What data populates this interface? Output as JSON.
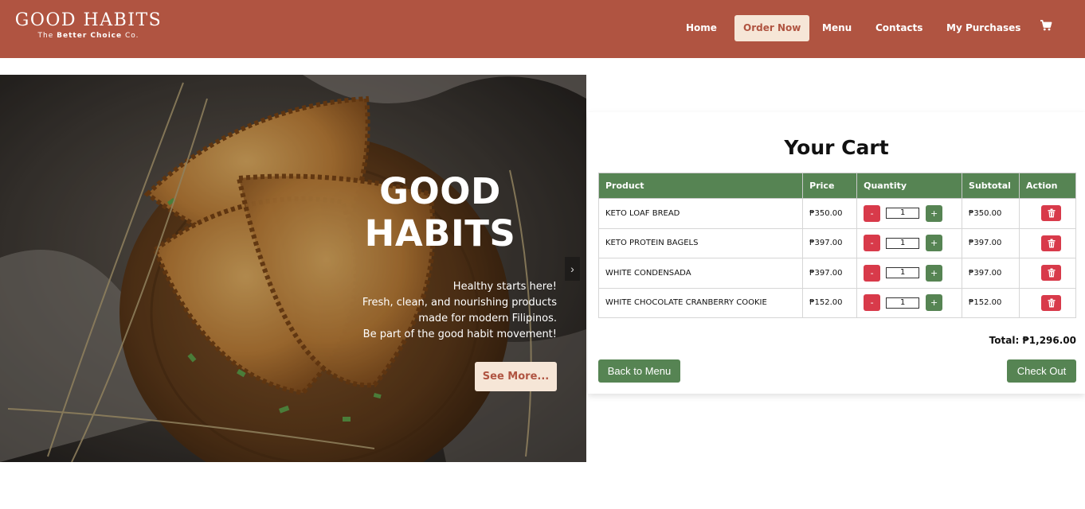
{
  "nav": {
    "brand_name": "GOOD HABITS",
    "brand_tag_prefix": "The ",
    "brand_tag_bold": "Better Choice",
    "brand_tag_suffix": " Co.",
    "items": [
      {
        "label": "Home"
      },
      {
        "label": "Order Now",
        "active": true
      },
      {
        "label": "Menu"
      },
      {
        "label": "Contacts"
      },
      {
        "label": "My Purchases"
      }
    ],
    "cart_icon": "shopping-cart-icon"
  },
  "hero": {
    "title_line1": "GOOD",
    "title_line2": "HABITS",
    "text_line1": "Healthy starts here!",
    "text_line2": "Fresh, clean, and nourishing products",
    "text_line3": "made for modern Filipinos.",
    "text_line4": "Be part of the good habit movement!",
    "button": "See More...",
    "next_arrow": "›"
  },
  "cart": {
    "title": "Your Cart",
    "columns": [
      "Product",
      "Price",
      "Quantity",
      "Subtotal",
      "Action"
    ],
    "rows": [
      {
        "product": "KETO LOAF BREAD",
        "price": "₱350.00",
        "qty": "1",
        "subtotal": "₱350.00"
      },
      {
        "product": "KETO PROTEIN BAGELS",
        "price": "₱397.00",
        "qty": "1",
        "subtotal": "₱397.00"
      },
      {
        "product": "WHITE CONDENSADA",
        "price": "₱397.00",
        "qty": "1",
        "subtotal": "₱397.00"
      },
      {
        "product": "WHITE CHOCOLATE CRANBERRY COOKIE",
        "price": "₱152.00",
        "qty": "1",
        "subtotal": "₱152.00"
      }
    ],
    "minus": "-",
    "plus": "+",
    "total": "Total: ₱1,296.00",
    "back_button": "Back to Menu",
    "checkout_button": "Check Out"
  },
  "colors": {
    "brand": "#b05441",
    "cream": "#f6e6d7",
    "green": "#568453",
    "red": "#d83a4a"
  }
}
